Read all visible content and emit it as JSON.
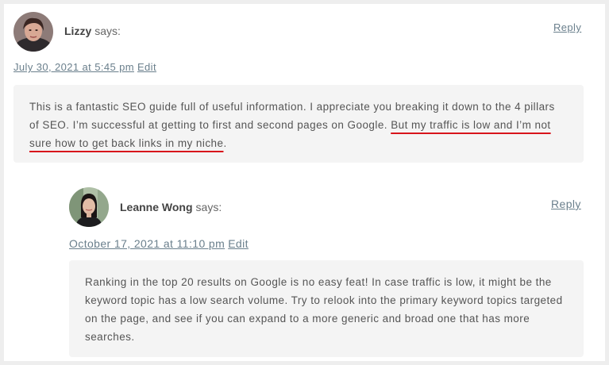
{
  "comments": [
    {
      "author": "Lizzy",
      "says": "says:",
      "reply": "Reply",
      "date": "July 30, 2021 at 5:45 pm",
      "edit": "Edit",
      "text_plain": "This is a fantastic SEO guide full of useful information. I appreciate you breaking it down to the 4 pillars of SEO. I’m successful at getting to first and second pages on Google. ",
      "text_highlight": "But my traffic is low and I’m not sure how to get back links in my niche",
      "text_end": "."
    },
    {
      "author": "Leanne Wong",
      "says": "says:",
      "reply": "Reply",
      "date": "October 17, 2021 at 11:10 pm",
      "edit": "Edit",
      "text": "Ranking in the top 20 results on Google is no easy feat! In case traffic is low, it might be the keyword topic has a low search volume. Try to relook into the primary keyword topics targeted on the page, and see if you can expand to a more generic and broad one that has more searches."
    }
  ],
  "colors": {
    "page_bg": "#eeeeee",
    "card_bg": "#ffffff",
    "bubble_bg": "#f4f4f4",
    "link": "#6a7f8c",
    "highlight_underline": "#d8141b"
  }
}
